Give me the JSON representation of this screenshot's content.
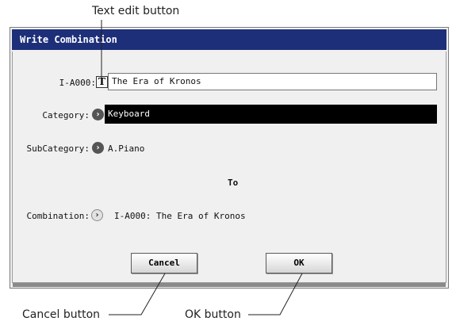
{
  "callouts": {
    "text_edit": "Text edit button",
    "cancel": "Cancel button",
    "ok": "OK button"
  },
  "dialog": {
    "title": "Write Combination",
    "name_row": {
      "label": "I-A000:",
      "text_edit_glyph": "T",
      "value": "The Era of Kronos"
    },
    "category": {
      "label": "Category:",
      "value": "Keyboard",
      "icon": "chevron-right-icon"
    },
    "subcategory": {
      "label": "SubCategory:",
      "value": "A.Piano",
      "icon": "chevron-right-icon"
    },
    "to_label": "To",
    "destination": {
      "label": "Combination:",
      "value": "I-A000: The Era of Kronos",
      "icon": "chevron-right-icon"
    },
    "buttons": {
      "cancel": "Cancel",
      "ok": "OK"
    }
  },
  "colors": {
    "titlebar": "#1e2f7a",
    "category_highlight": "#000000",
    "dialog_bg": "#f0f0f0"
  }
}
